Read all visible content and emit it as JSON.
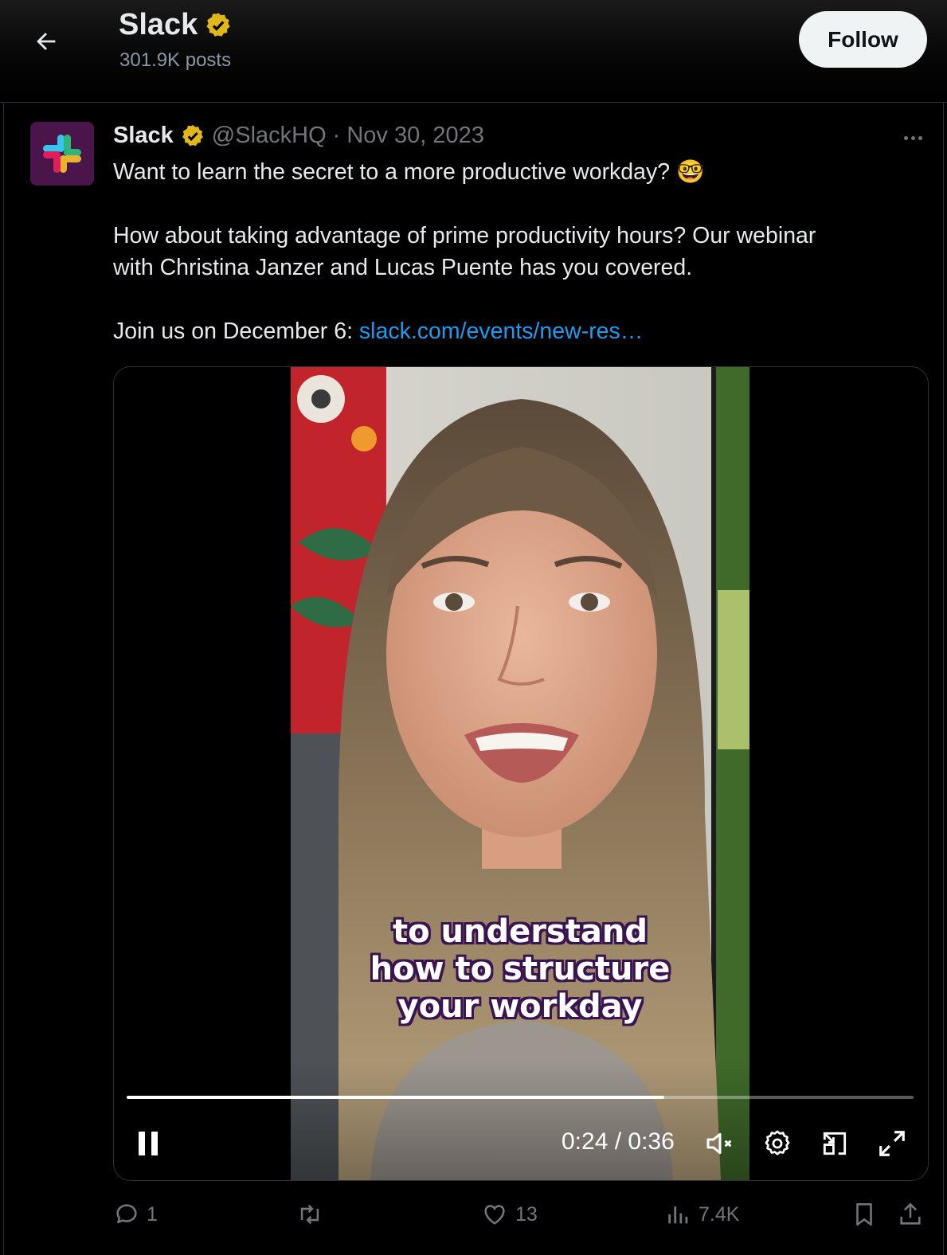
{
  "header": {
    "title": "Slack",
    "posts": "301.9K posts",
    "follow_label": "Follow"
  },
  "tweet": {
    "author_name": "Slack",
    "handle": "@SlackHQ",
    "separator": "·",
    "date": "Nov 30, 2023",
    "line1": "Want to learn the secret to a more productive workday? 🤓",
    "line2": "How about taking advantage of prime productivity hours? Our webinar",
    "line3": "with Christina Janzer and Lucas Puente has you covered.",
    "line4_prefix": "Join us on December 6: ",
    "link": "slack.com/events/new-res…"
  },
  "video": {
    "caption_line1": "to understand",
    "caption_line2": "how to structure",
    "caption_line3": "your workday",
    "time": "0:24 / 0:36",
    "progress": 0.683
  },
  "actions": {
    "replies": "1",
    "reposts": "",
    "likes": "13",
    "views": "7.4K"
  },
  "colors": {
    "background": "#000000",
    "link": "#1d9bf0",
    "muted": "#71767b",
    "verified": "#e2b719",
    "avatar_bg": "#4a154b"
  },
  "icons": [
    "back-arrow-icon",
    "verified-badge-icon",
    "more-icon",
    "pause-icon",
    "mute-icon",
    "settings-icon",
    "pip-icon",
    "fullscreen-icon",
    "reply-icon",
    "repost-icon",
    "like-icon",
    "views-icon",
    "bookmark-icon",
    "share-icon"
  ]
}
